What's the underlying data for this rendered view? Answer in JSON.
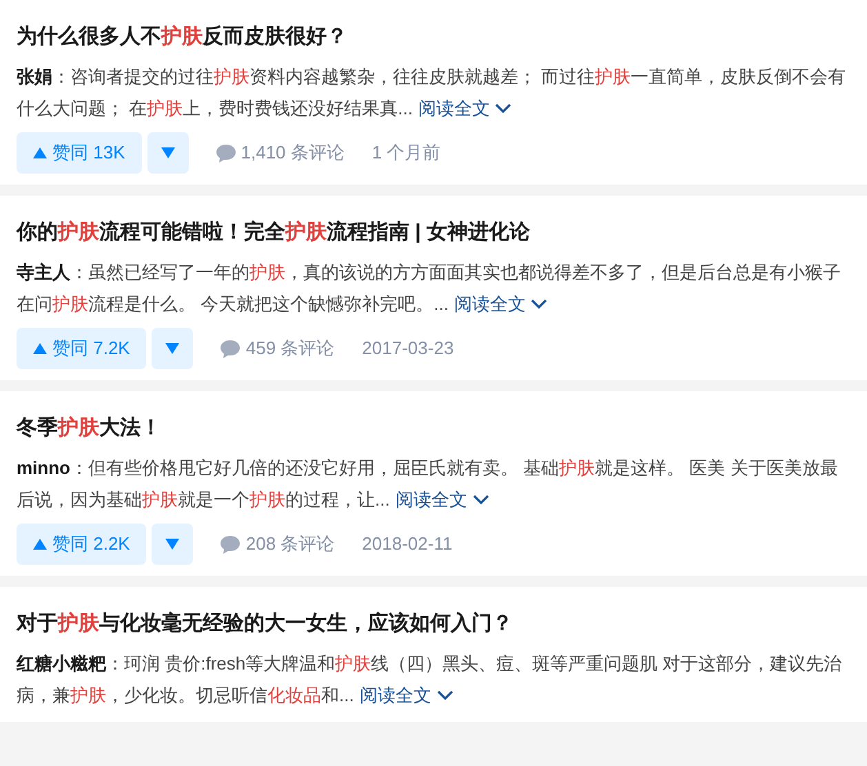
{
  "items": [
    {
      "title": [
        {
          "text": "为什么很多人不",
          "highlight": false
        },
        {
          "text": "护肤",
          "highlight": true
        },
        {
          "text": "反而皮肤很好？",
          "highlight": false
        }
      ],
      "author": "张娟",
      "excerpt": [
        {
          "text": "：咨询者提交的过往",
          "highlight": false
        },
        {
          "text": "护肤",
          "highlight": true
        },
        {
          "text": "资料内容越繁杂，往往皮肤就越差； 而过往",
          "highlight": false
        },
        {
          "text": "护肤",
          "highlight": true
        },
        {
          "text": "一直简单，皮肤反倒不会有什么大问题； 在",
          "highlight": false
        },
        {
          "text": "护肤",
          "highlight": true
        },
        {
          "text": "上，费时费钱还没好结果真...",
          "highlight": false
        }
      ],
      "read_more": "阅读全文",
      "vote": "赞同 13K",
      "comments": "1,410 条评论",
      "time": "1 个月前"
    },
    {
      "title": [
        {
          "text": "你的",
          "highlight": false
        },
        {
          "text": "护肤",
          "highlight": true
        },
        {
          "text": "流程可能错啦！完全",
          "highlight": false
        },
        {
          "text": "护肤",
          "highlight": true
        },
        {
          "text": "流程指南 | 女神进化论",
          "highlight": false
        }
      ],
      "author": "寺主人",
      "excerpt": [
        {
          "text": "：虽然已经写了一年的",
          "highlight": false
        },
        {
          "text": "护肤",
          "highlight": true
        },
        {
          "text": "，真的该说的方方面面其实也都说得差不多了，但是后台总是有小猴子在问",
          "highlight": false
        },
        {
          "text": "护肤",
          "highlight": true
        },
        {
          "text": "流程是什么。 今天就把这个缺憾弥补完吧。...",
          "highlight": false
        }
      ],
      "read_more": "阅读全文",
      "vote": "赞同 7.2K",
      "comments": "459 条评论",
      "time": "2017-03-23"
    },
    {
      "title": [
        {
          "text": "冬季",
          "highlight": false
        },
        {
          "text": "护肤",
          "highlight": true
        },
        {
          "text": "大法！",
          "highlight": false
        }
      ],
      "author": "minno",
      "excerpt": [
        {
          "text": "：但有些价格甩它好几倍的还没它好用，屈臣氏就有卖。 基础",
          "highlight": false
        },
        {
          "text": "护肤",
          "highlight": true
        },
        {
          "text": "就是这样。 医美 关于医美放最后说，因为基础",
          "highlight": false
        },
        {
          "text": "护肤",
          "highlight": true
        },
        {
          "text": "就是一个",
          "highlight": false
        },
        {
          "text": "护肤",
          "highlight": true
        },
        {
          "text": "的过程，让...",
          "highlight": false
        }
      ],
      "read_more": "阅读全文",
      "vote": "赞同 2.2K",
      "comments": "208 条评论",
      "time": "2018-02-11"
    },
    {
      "title": [
        {
          "text": "对于",
          "highlight": false
        },
        {
          "text": "护肤",
          "highlight": true
        },
        {
          "text": "与化妆毫无经验的大一女生，应该如何入门？",
          "highlight": false
        }
      ],
      "author": "红糖小糍粑",
      "excerpt": [
        {
          "text": "：珂润 贵价:fresh等大牌温和",
          "highlight": false
        },
        {
          "text": "护肤",
          "highlight": true
        },
        {
          "text": "线（四）黑头、痘、斑等严重问题肌 对于这部分，建议先治病，兼",
          "highlight": false
        },
        {
          "text": "护肤",
          "highlight": true
        },
        {
          "text": "，少化妆。切忌听信",
          "highlight": false
        },
        {
          "text": "化妆品",
          "highlight": true
        },
        {
          "text": "和...",
          "highlight": false
        }
      ],
      "read_more": "阅读全文"
    }
  ]
}
